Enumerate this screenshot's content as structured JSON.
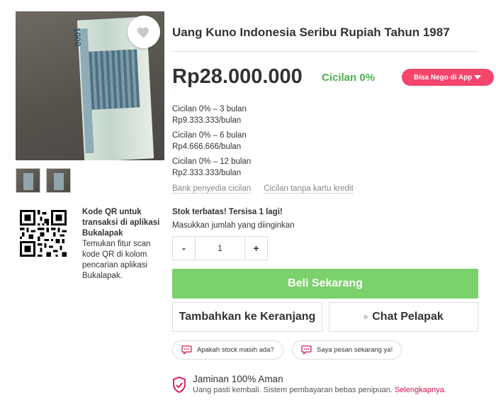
{
  "product": {
    "title": "Uang Kuno Indonesia Seribu Rupiah Tahun 1987",
    "price": "Rp28.000.000",
    "cicilan_badge": "Cicilan 0%",
    "nego_label": "Bisa Nego di App",
    "banknote_number": "1000"
  },
  "installments": [
    {
      "term": "Cicilan 0% – 3 bulan",
      "amount": "Rp9.333.333/bulan"
    },
    {
      "term": "Cicilan 0% – 6 bulan",
      "amount": "Rp4.666.666/bulan"
    },
    {
      "term": "Cicilan 0% – 12 bulan",
      "amount": "Rp2.333.333/bulan"
    }
  ],
  "installment_links": {
    "banks": "Bank penyedia cicilan",
    "no_card": "Cicilan tanpa kartu kredit"
  },
  "stock": {
    "warning": "Stok terbatas! Tersisa 1 lagi!",
    "qty_label": "Masukkan jumlah yang diinginkan",
    "qty_value": "1",
    "minus": "-",
    "plus": "+"
  },
  "actions": {
    "buy": "Beli Sekarang",
    "cart": "Tambahkan ke Keranjang",
    "chat": "Chat Pelapak"
  },
  "quick_questions": [
    "Apakah stock masih ada?",
    "Saya pesan sekarang ya!"
  ],
  "qr": {
    "title": "Kode QR untuk transaksi di aplikasi Bukalapak",
    "desc": "Temukan fitur scan kode QR di kolom pencarian aplikasi Bukalapak."
  },
  "guarantee": {
    "title": "Jaminan 100% Aman",
    "desc": "Uang pasti kembali. Sistem pembayaran bebas penipuan.",
    "link": "Selengkapnya."
  },
  "colors": {
    "accent": "#d71149",
    "buy_green": "#7bd16c",
    "cicilan_green": "#4caf50",
    "nego_pink": "#f5456c"
  },
  "icons": {
    "wishlist": "heart-icon",
    "chat": "chat-bubble-icon",
    "guarantee": "shield-check-icon"
  }
}
